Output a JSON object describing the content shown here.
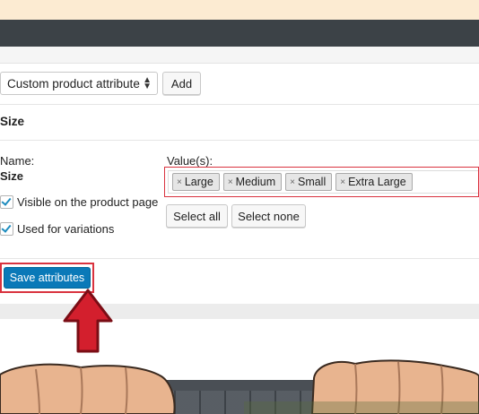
{
  "attribute_select": {
    "value": "Custom product attribute",
    "arrows": "▲\n▼"
  },
  "buttons": {
    "add": "Add",
    "select_all": "Select all",
    "select_none": "Select none",
    "save": "Save attributes"
  },
  "attribute": {
    "heading": "Size",
    "name_label": "Name:",
    "name_value": "Size",
    "values_label": "Value(s):",
    "values": [
      "Large",
      "Medium",
      "Small",
      "Extra Large"
    ],
    "chip_remove": "×"
  },
  "options": {
    "visible_label": "Visible on the product page",
    "visible_checked": true,
    "variations_label": "Used for variations",
    "variations_checked": true
  },
  "colors": {
    "highlight_red": "#d9333f",
    "primary_blue": "#0a79b8"
  }
}
